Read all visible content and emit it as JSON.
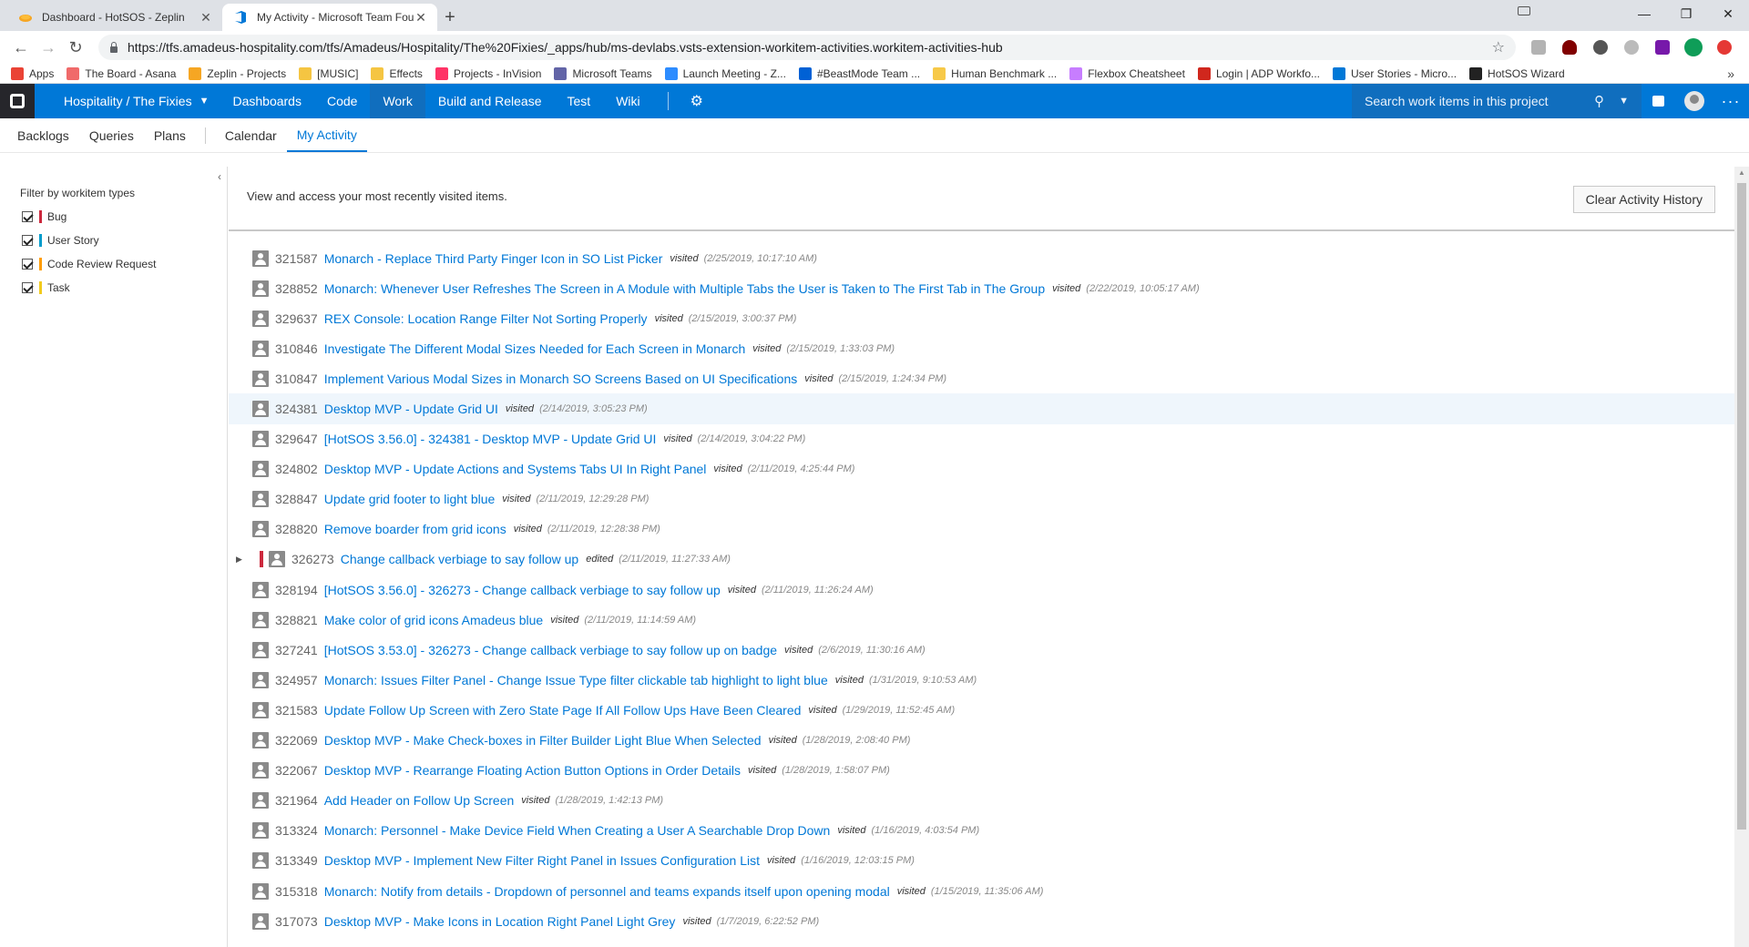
{
  "browser": {
    "tabs": [
      {
        "title": "Dashboard - HotSOS - Zeplin",
        "active": false,
        "favicon_color": "#f6a623"
      },
      {
        "title": "My Activity - Microsoft Team Fou",
        "active": true,
        "favicon_color": "#0078d7"
      }
    ],
    "url": "https://tfs.amadeus-hospitality.com/tfs/Amadeus/Hospitality/The%20Fixies/_apps/hub/ms-devlabs.vsts-extension-workitem-activities.workitem-activities-hub",
    "window_controls": {
      "minimize": "—",
      "restore": "❐",
      "close": "✕"
    },
    "bookmarks": [
      {
        "label": "Apps",
        "color": "#ea4335"
      },
      {
        "label": "The Board - Asana",
        "color": "#f06a6a"
      },
      {
        "label": "Zeplin - Projects",
        "color": "#f6a623"
      },
      {
        "label": "[MUSIC]",
        "color": "#f5c542"
      },
      {
        "label": "Effects",
        "color": "#f5c542"
      },
      {
        "label": "Projects - InVision",
        "color": "#ff3366"
      },
      {
        "label": "Microsoft Teams",
        "color": "#6264a7"
      },
      {
        "label": "Launch Meeting - Z...",
        "color": "#2d8cff"
      },
      {
        "label": "#BeastMode Team ...",
        "color": "#0061d5"
      },
      {
        "label": "Human Benchmark ...",
        "color": "#f7c948"
      },
      {
        "label": "Flexbox Cheatsheet",
        "color": "#c77dff"
      },
      {
        "label": "Login | ADP Workfo...",
        "color": "#d0271d"
      },
      {
        "label": "User Stories - Micro...",
        "color": "#0078d7"
      },
      {
        "label": "HotSOS Wizard",
        "color": "#222222"
      }
    ],
    "bookmarks_more": "»"
  },
  "appbar": {
    "project": "Hospitality / The Fixies",
    "hubs": [
      "Dashboards",
      "Code",
      "Work",
      "Build and Release",
      "Test",
      "Wiki"
    ],
    "active_hub": "Work",
    "search_placeholder": "Search work items in this project"
  },
  "subnav": {
    "tabs": [
      "Backlogs",
      "Queries",
      "Plans",
      "Calendar",
      "My Activity"
    ],
    "active": "My Activity"
  },
  "filter": {
    "title": "Filter by workitem types",
    "types": [
      {
        "label": "Bug",
        "color": "#cc293d",
        "checked": true
      },
      {
        "label": "User Story",
        "color": "#009ccc",
        "checked": true
      },
      {
        "label": "Code Review Request",
        "color": "#ff9d00",
        "checked": true
      },
      {
        "label": "Task",
        "color": "#f2cb1d",
        "checked": true
      }
    ]
  },
  "main": {
    "intro": "View and access your most recently visited items.",
    "clear_button": "Clear Activity History",
    "items": [
      {
        "id": "321587",
        "title": "Monarch - Replace Third Party Finger Icon in SO List Picker",
        "action": "visited",
        "date": "(2/25/2019, 10:17:10 AM)"
      },
      {
        "id": "328852",
        "title": "Monarch: Whenever User Refreshes The Screen in A Module with Multiple Tabs the User is Taken to The First Tab in The Group",
        "action": "visited",
        "date": "(2/22/2019, 10:05:17 AM)"
      },
      {
        "id": "329637",
        "title": "REX Console: Location Range Filter Not Sorting Properly",
        "action": "visited",
        "date": "(2/15/2019, 3:00:37 PM)"
      },
      {
        "id": "310846",
        "title": "Investigate The Different Modal Sizes Needed for Each Screen in Monarch",
        "action": "visited",
        "date": "(2/15/2019, 1:33:03 PM)"
      },
      {
        "id": "310847",
        "title": "Implement Various Modal Sizes in Monarch SO Screens Based on UI Specifications",
        "action": "visited",
        "date": "(2/15/2019, 1:24:34 PM)"
      },
      {
        "id": "324381",
        "title": "Desktop MVP - Update Grid UI",
        "action": "visited",
        "date": "(2/14/2019, 3:05:23 PM)",
        "selected": true
      },
      {
        "id": "329647",
        "title": "[HotSOS 3.56.0] - 324381 - Desktop MVP - Update Grid UI",
        "action": "visited",
        "date": "(2/14/2019, 3:04:22 PM)"
      },
      {
        "id": "324802",
        "title": "Desktop MVP - Update Actions and Systems Tabs UI In Right Panel",
        "action": "visited",
        "date": "(2/11/2019, 4:25:44 PM)"
      },
      {
        "id": "328847",
        "title": "Update grid footer to light blue",
        "action": "visited",
        "date": "(2/11/2019, 12:29:28 PM)"
      },
      {
        "id": "328820",
        "title": "Remove boarder from grid icons",
        "action": "visited",
        "date": "(2/11/2019, 12:28:38 PM)"
      },
      {
        "id": "326273",
        "title": "Change callback verbiage to say follow up",
        "action": "edited",
        "date": "(2/11/2019, 11:27:33 AM)",
        "parent": true
      },
      {
        "id": "328194",
        "title": "[HotSOS 3.56.0] - 326273 - Change callback verbiage to say follow up",
        "action": "visited",
        "date": "(2/11/2019, 11:26:24 AM)"
      },
      {
        "id": "328821",
        "title": "Make color of grid icons Amadeus blue",
        "action": "visited",
        "date": "(2/11/2019, 11:14:59 AM)"
      },
      {
        "id": "327241",
        "title": "[HotSOS 3.53.0] - 326273 - Change callback verbiage to say follow up on badge",
        "action": "visited",
        "date": "(2/6/2019, 11:30:16 AM)"
      },
      {
        "id": "324957",
        "title": "Monarch: Issues Filter Panel - Change Issue Type filter clickable tab highlight to light blue",
        "action": "visited",
        "date": "(1/31/2019, 9:10:53 AM)"
      },
      {
        "id": "321583",
        "title": "Update Follow Up Screen with Zero State Page If All Follow Ups Have Been Cleared",
        "action": "visited",
        "date": "(1/29/2019, 11:52:45 AM)"
      },
      {
        "id": "322069",
        "title": "Desktop MVP - Make Check-boxes in Filter Builder Light Blue When Selected",
        "action": "visited",
        "date": "(1/28/2019, 2:08:40 PM)"
      },
      {
        "id": "322067",
        "title": "Desktop MVP - Rearrange Floating Action Button Options in Order Details",
        "action": "visited",
        "date": "(1/28/2019, 1:58:07 PM)"
      },
      {
        "id": "321964",
        "title": "Add Header on Follow Up Screen",
        "action": "visited",
        "date": "(1/28/2019, 1:42:13 PM)"
      },
      {
        "id": "313324",
        "title": "Monarch: Personnel - Make Device Field When Creating a User A Searchable Drop Down",
        "action": "visited",
        "date": "(1/16/2019, 4:03:54 PM)"
      },
      {
        "id": "313349",
        "title": "Desktop MVP - Implement New Filter Right Panel in Issues Configuration List",
        "action": "visited",
        "date": "(1/16/2019, 12:03:15 PM)"
      },
      {
        "id": "315318",
        "title": "Monarch: Notify from details - Dropdown of personnel and teams expands itself upon opening modal",
        "action": "visited",
        "date": "(1/15/2019, 11:35:06 AM)"
      },
      {
        "id": "317073",
        "title": "Desktop MVP - Make Icons in Location Right Panel Light Grey",
        "action": "visited",
        "date": "(1/7/2019, 6:22:52 PM)"
      }
    ]
  }
}
